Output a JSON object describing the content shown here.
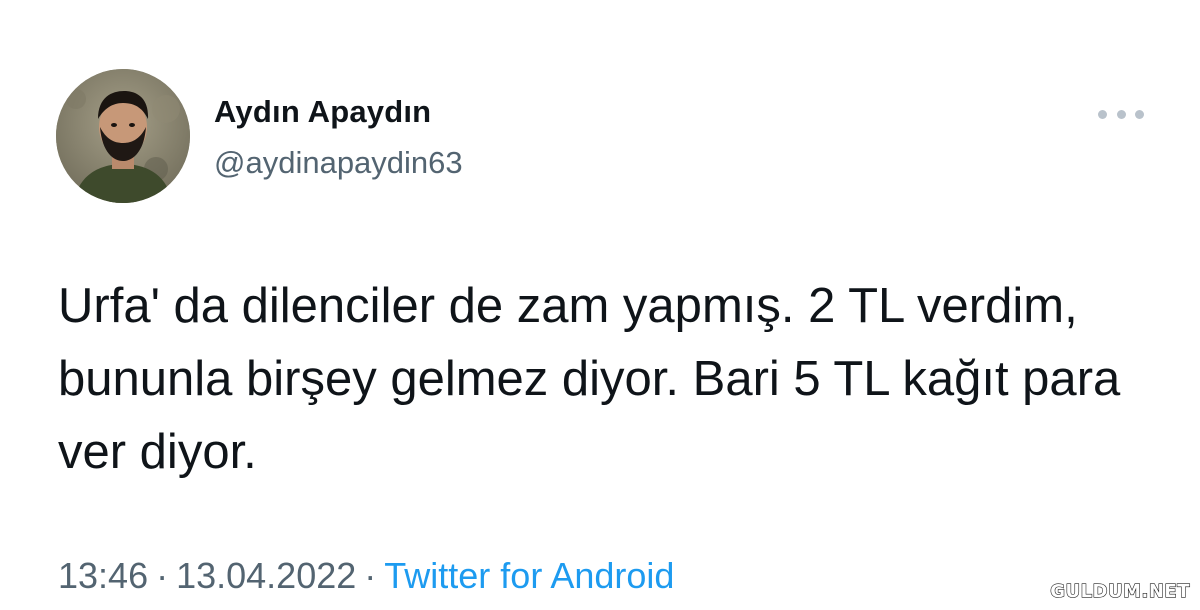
{
  "tweet": {
    "author": {
      "display_name": "Aydın Apaydın",
      "handle": "@aydinapaydin63",
      "avatar_icon": "profile-photo"
    },
    "more_icon": "more-dots-icon",
    "text": "Urfa' da dilenciler de zam yapmış. 2 TL verdim, bununla birşey gelmez diyor. Bari 5 TL kağıt para ver diyor.",
    "time": "13:46",
    "separator": "·",
    "date": "13.04.2022",
    "source": "Twitter for Android"
  },
  "watermark": "GULDUM.NET",
  "colors": {
    "text": "#0f1419",
    "secondary": "#536471",
    "link": "#1d9bf0"
  }
}
